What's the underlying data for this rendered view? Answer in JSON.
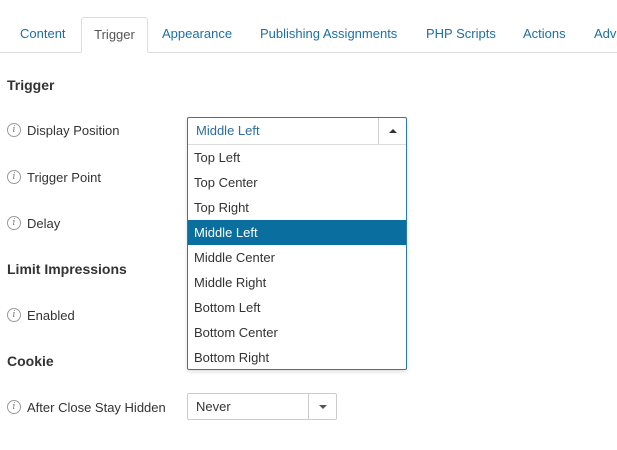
{
  "tabs": [
    {
      "label": "Content",
      "active": false
    },
    {
      "label": "Trigger",
      "active": true
    },
    {
      "label": "Appearance",
      "active": false
    },
    {
      "label": "Publishing Assignments",
      "active": false
    },
    {
      "label": "PHP Scripts",
      "active": false
    },
    {
      "label": "Actions",
      "active": false
    },
    {
      "label": "Adv",
      "active": false
    }
  ],
  "sections": {
    "trigger": "Trigger",
    "limit_impressions": "Limit Impressions",
    "cookie": "Cookie"
  },
  "fields": {
    "display_position": {
      "label": "Display Position",
      "value": "Middle Left",
      "options": [
        "Top Left",
        "Top Center",
        "Top Right",
        "Middle Left",
        "Middle Center",
        "Middle Right",
        "Bottom Left",
        "Bottom Center",
        "Bottom Right"
      ],
      "selected_index": 3
    },
    "trigger_point": {
      "label": "Trigger Point"
    },
    "delay": {
      "label": "Delay"
    },
    "enabled": {
      "label": "Enabled"
    },
    "after_close_stay_hidden": {
      "label": "After Close Stay Hidden",
      "value": "Never"
    }
  },
  "icons": {
    "info": "info-icon",
    "arrow_up": "caret-up-icon",
    "arrow_down": "caret-down-icon"
  },
  "colors": {
    "link": "#1d6fa5",
    "selected_option_bg": "#0a6e9e",
    "dropdown_border": "#2a7ab0"
  }
}
